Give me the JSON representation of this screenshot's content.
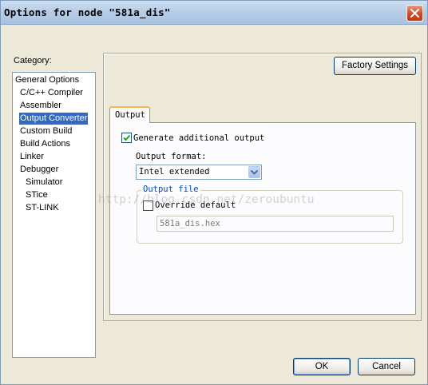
{
  "window": {
    "title": "Options for node \"581a_dis\""
  },
  "category": {
    "label": "Category:",
    "items": [
      {
        "label": "General Options",
        "indent": false,
        "selected": false
      },
      {
        "label": "C/C++ Compiler",
        "indent": true,
        "selected": false
      },
      {
        "label": "Assembler",
        "indent": true,
        "selected": false
      },
      {
        "label": "Output Converter",
        "indent": true,
        "selected": true
      },
      {
        "label": "Custom Build",
        "indent": true,
        "selected": false
      },
      {
        "label": "Build Actions",
        "indent": true,
        "selected": false
      },
      {
        "label": "Linker",
        "indent": true,
        "selected": false
      },
      {
        "label": "Debugger",
        "indent": true,
        "selected": false
      },
      {
        "label": "Simulator",
        "indent": true,
        "selected": false,
        "sub": true
      },
      {
        "label": "STice",
        "indent": true,
        "selected": false,
        "sub": true
      },
      {
        "label": "ST-LINK",
        "indent": true,
        "selected": false,
        "sub": true
      }
    ]
  },
  "panel": {
    "factory_settings_label": "Factory Settings",
    "tab_output": "Output",
    "generate_output_label": "Generate additional output",
    "generate_output_checked": true,
    "output_format_label": "Output format:",
    "output_format_value": "Intel extended",
    "output_file_group": "Output file",
    "override_default_label": "Override default",
    "override_default_checked": false,
    "output_file_value": "581a_dis.hex"
  },
  "watermark": "http://blog.csdn.net/zeroubuntu",
  "buttons": {
    "ok": "OK",
    "cancel": "Cancel"
  }
}
